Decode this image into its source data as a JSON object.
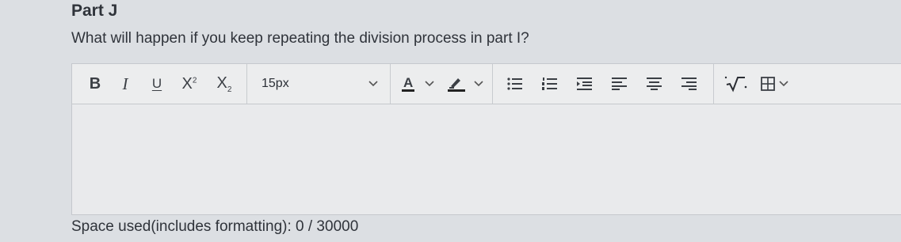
{
  "part": {
    "title": "Part J"
  },
  "question": {
    "text": "What will happen if you keep repeating the division process in part I?"
  },
  "toolbar": {
    "bold_label": "B",
    "italic_label": "I",
    "underline_label": "U",
    "superscript_base": "X",
    "superscript_sup": "2",
    "subscript_base": "X",
    "subscript_sub": "2",
    "font_size_value": "15px",
    "font_color_label": "A",
    "icons": [
      "bold-icon",
      "italic-icon",
      "underline-icon",
      "superscript-icon",
      "subscript-icon",
      "chevron-down-icon",
      "font-color-icon",
      "highlight-icon",
      "bulleted-list-icon",
      "numbered-list-icon",
      "decrease-indent-icon",
      "align-left-icon",
      "align-center-icon",
      "align-right-icon",
      "equation-icon",
      "table-icon"
    ]
  },
  "editor": {
    "value": ""
  },
  "footer": {
    "space_used": "Space used(includes formatting): 0 / 30000"
  },
  "colors": {
    "background": "#dcdfe3",
    "editor_bg": "#e9eaec",
    "border": "#c5c8cd",
    "text": "#2f333a"
  }
}
